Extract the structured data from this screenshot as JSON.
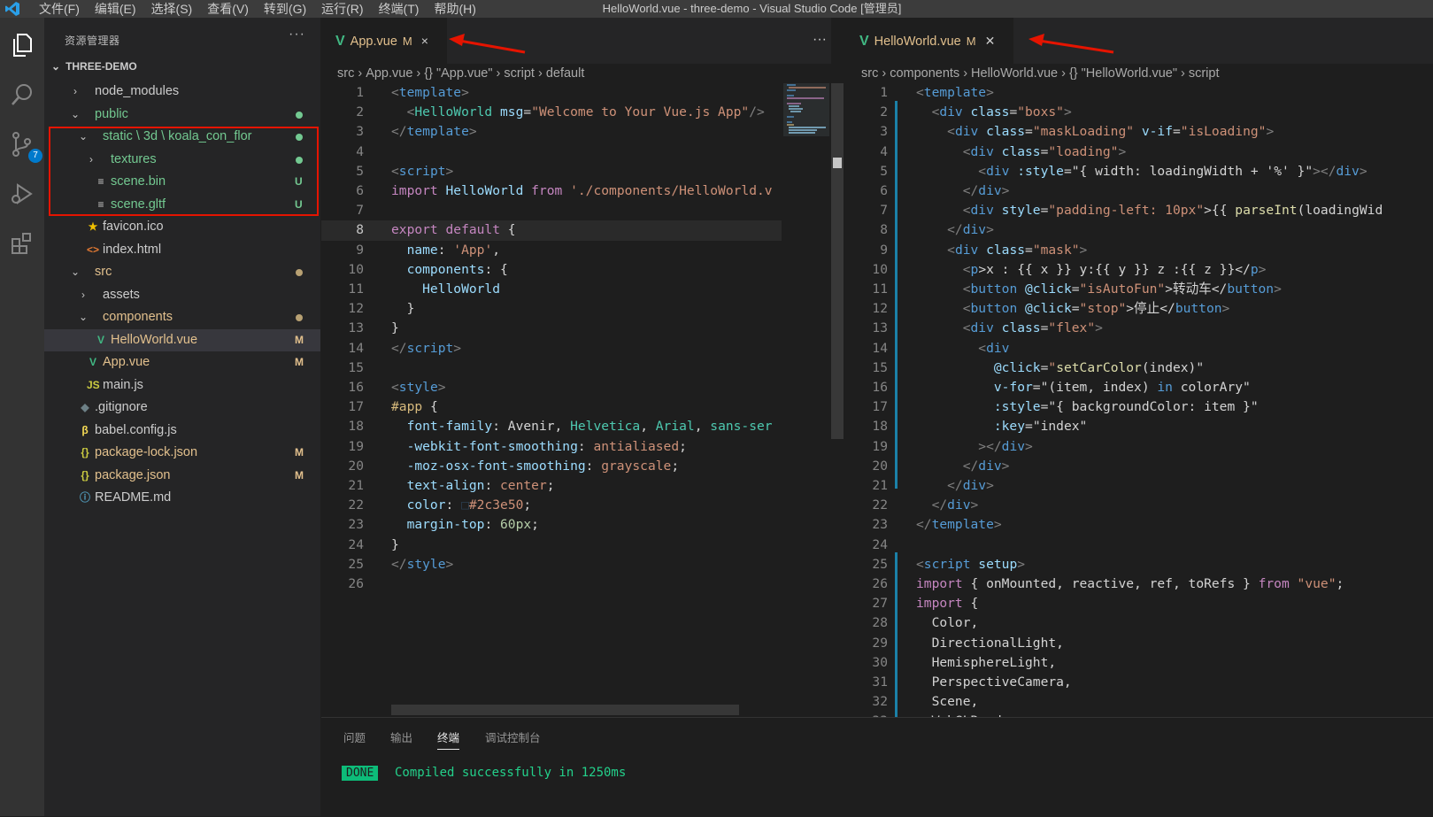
{
  "window": {
    "title": "HelloWorld.vue - three-demo - Visual Studio Code [管理员]",
    "menu": [
      "文件(F)",
      "编辑(E)",
      "选择(S)",
      "查看(V)",
      "转到(G)",
      "运行(R)",
      "终端(T)",
      "帮助(H)"
    ]
  },
  "activity": {
    "scm_badge": "7"
  },
  "explorer": {
    "title": "资源管理器",
    "more": "···",
    "section": "THREE-DEMO",
    "items": [
      {
        "twisty": "›",
        "icon": "",
        "name": "node_modules",
        "status": "",
        "color": "#cccccc"
      },
      {
        "twisty": "⌄",
        "icon": "",
        "name": "public",
        "status": "",
        "color": "#73c991"
      },
      {
        "twisty": "⌄",
        "icon": "",
        "name": "static \\ 3d \\ koala_con_flor",
        "status": "",
        "color": "#73c991"
      },
      {
        "twisty": "›",
        "icon": "",
        "name": "textures",
        "status": "",
        "color": "#73c991"
      },
      {
        "twisty": "",
        "icon": "≡",
        "name": "scene.bin",
        "status": "U",
        "color": "#73c991"
      },
      {
        "twisty": "",
        "icon": "≡",
        "name": "scene.gltf",
        "status": "U",
        "color": "#73c991"
      },
      {
        "twisty": "",
        "icon": "★",
        "name": "favicon.ico",
        "status": "",
        "color": "#cccccc"
      },
      {
        "twisty": "",
        "icon": "<>",
        "name": "index.html",
        "status": "",
        "color": "#cccccc"
      },
      {
        "twisty": "⌄",
        "icon": "",
        "name": "src",
        "status": "",
        "color": "#e2c08d"
      },
      {
        "twisty": "›",
        "icon": "",
        "name": "assets",
        "status": "",
        "color": "#cccccc"
      },
      {
        "twisty": "⌄",
        "icon": "",
        "name": "components",
        "status": "",
        "color": "#e2c08d"
      },
      {
        "twisty": "",
        "icon": "V",
        "name": "HelloWorld.vue",
        "status": "M",
        "color": "#e2c08d"
      },
      {
        "twisty": "",
        "icon": "V",
        "name": "App.vue",
        "status": "M",
        "color": "#e2c08d"
      },
      {
        "twisty": "",
        "icon": "JS",
        "name": "main.js",
        "status": "",
        "color": "#cccccc"
      },
      {
        "twisty": "",
        "icon": "◆",
        "name": ".gitignore",
        "status": "",
        "color": "#cccccc"
      },
      {
        "twisty": "",
        "icon": "β",
        "name": "babel.config.js",
        "status": "",
        "color": "#cccccc"
      },
      {
        "twisty": "",
        "icon": "{}",
        "name": "package-lock.json",
        "status": "M",
        "color": "#e2c08d"
      },
      {
        "twisty": "",
        "icon": "{}",
        "name": "package.json",
        "status": "M",
        "color": "#e2c08d"
      },
      {
        "twisty": "",
        "icon": "ⓘ",
        "name": "README.md",
        "status": "",
        "color": "#cccccc"
      }
    ]
  },
  "left_editor": {
    "tab": {
      "name": "App.vue",
      "mod": "M",
      "close": "×"
    },
    "more": "···",
    "breadcrumb": [
      "src",
      "›",
      "App.vue",
      "›",
      "{} \"App.vue\"",
      "›",
      "script",
      "›",
      "default"
    ],
    "current_line": 8,
    "lines": [
      [
        [
          "<",
          "#808080"
        ],
        [
          "template",
          "#569cd6"
        ],
        [
          ">",
          "#808080"
        ]
      ],
      [
        [
          "  <",
          "#808080"
        ],
        [
          "HelloWorld",
          "#4ec9b0"
        ],
        [
          " msg",
          "#9cdcfe"
        ],
        [
          "=",
          "#d4d4d4"
        ],
        [
          "\"Welcome to Your Vue.js App\"",
          "#ce9178"
        ],
        [
          "/>",
          "#808080"
        ]
      ],
      [
        [
          "</",
          "#808080"
        ],
        [
          "template",
          "#569cd6"
        ],
        [
          ">",
          "#808080"
        ]
      ],
      [],
      [
        [
          "<",
          "#808080"
        ],
        [
          "script",
          "#569cd6"
        ],
        [
          ">",
          "#808080"
        ]
      ],
      [
        [
          "import ",
          "#c586c0"
        ],
        [
          "HelloWorld ",
          "#9cdcfe"
        ],
        [
          "from ",
          "#c586c0"
        ],
        [
          "'./components/HelloWorld.v",
          "#ce9178"
        ]
      ],
      [],
      [
        [
          "export default ",
          "#c586c0"
        ],
        [
          "{",
          "#d4d4d4"
        ]
      ],
      [
        [
          "  name",
          "#9cdcfe"
        ],
        [
          ": ",
          "#d4d4d4"
        ],
        [
          "'App'",
          "#ce9178"
        ],
        [
          ",",
          "#d4d4d4"
        ]
      ],
      [
        [
          "  components",
          "#9cdcfe"
        ],
        [
          ": {",
          "#d4d4d4"
        ]
      ],
      [
        [
          "    HelloWorld",
          "#9cdcfe"
        ]
      ],
      [
        [
          "  }",
          "#d4d4d4"
        ]
      ],
      [
        [
          "}",
          "#d4d4d4"
        ]
      ],
      [
        [
          "</",
          "#808080"
        ],
        [
          "script",
          "#569cd6"
        ],
        [
          ">",
          "#808080"
        ]
      ],
      [],
      [
        [
          "<",
          "#808080"
        ],
        [
          "style",
          "#569cd6"
        ],
        [
          ">",
          "#808080"
        ]
      ],
      [
        [
          "#app ",
          "#d7ba7d"
        ],
        [
          "{",
          "#d4d4d4"
        ]
      ],
      [
        [
          "  font-family",
          "#9cdcfe"
        ],
        [
          ": Avenir, ",
          "#d4d4d4"
        ],
        [
          "Helvetica",
          "#4ec9b0"
        ],
        [
          ", ",
          "#d4d4d4"
        ],
        [
          "Arial",
          "#4ec9b0"
        ],
        [
          ", ",
          "#d4d4d4"
        ],
        [
          "sans-ser",
          "#4ec9b0"
        ]
      ],
      [
        [
          "  -webkit-font-smoothing",
          "#9cdcfe"
        ],
        [
          ": ",
          "#d4d4d4"
        ],
        [
          "antialiased",
          "#ce9178"
        ],
        [
          ";",
          "#d4d4d4"
        ]
      ],
      [
        [
          "  -moz-osx-font-smoothing",
          "#9cdcfe"
        ],
        [
          ": ",
          "#d4d4d4"
        ],
        [
          "grayscale",
          "#ce9178"
        ],
        [
          ";",
          "#d4d4d4"
        ]
      ],
      [
        [
          "  text-align",
          "#9cdcfe"
        ],
        [
          ": ",
          "#d4d4d4"
        ],
        [
          "center",
          "#ce9178"
        ],
        [
          ";",
          "#d4d4d4"
        ]
      ],
      [
        [
          "  color",
          "#9cdcfe"
        ],
        [
          ": ",
          "#d4d4d4"
        ],
        [
          "□",
          "#2c3e50"
        ],
        [
          "#2c3e50",
          "#ce9178"
        ],
        [
          ";",
          "#d4d4d4"
        ]
      ],
      [
        [
          "  margin-top",
          "#9cdcfe"
        ],
        [
          ": ",
          "#d4d4d4"
        ],
        [
          "60",
          "#b5cea8"
        ],
        [
          "px",
          "#b5cea8"
        ],
        [
          ";",
          "#d4d4d4"
        ]
      ],
      [
        [
          "}",
          "#d4d4d4"
        ]
      ],
      [
        [
          "</",
          "#808080"
        ],
        [
          "style",
          "#569cd6"
        ],
        [
          ">",
          "#808080"
        ]
      ],
      []
    ]
  },
  "right_editor": {
    "tab": {
      "name": "HelloWorld.vue",
      "mod": "M",
      "close": "✕"
    },
    "breadcrumb": [
      "src",
      "›",
      "components",
      "›",
      "HelloWorld.vue",
      "›",
      "{} \"HelloWorld.vue\"",
      "›",
      "script"
    ],
    "lines": [
      [
        [
          "<",
          "#808080"
        ],
        [
          "template",
          "#569cd6"
        ],
        [
          ">",
          "#808080"
        ]
      ],
      [
        [
          "  <",
          "#808080"
        ],
        [
          "div",
          "#569cd6"
        ],
        [
          " class",
          "#9cdcfe"
        ],
        [
          "=",
          "#d4d4d4"
        ],
        [
          "\"boxs\"",
          "#ce9178"
        ],
        [
          ">",
          "#808080"
        ]
      ],
      [
        [
          "    <",
          "#808080"
        ],
        [
          "div",
          "#569cd6"
        ],
        [
          " class",
          "#9cdcfe"
        ],
        [
          "=",
          "#d4d4d4"
        ],
        [
          "\"maskLoading\"",
          "#ce9178"
        ],
        [
          " v-if",
          "#9cdcfe"
        ],
        [
          "=",
          "#d4d4d4"
        ],
        [
          "\"isLoading\"",
          "#ce9178"
        ],
        [
          ">",
          "#808080"
        ]
      ],
      [
        [
          "      <",
          "#808080"
        ],
        [
          "div",
          "#569cd6"
        ],
        [
          " class",
          "#9cdcfe"
        ],
        [
          "=",
          "#d4d4d4"
        ],
        [
          "\"loading\"",
          "#ce9178"
        ],
        [
          ">",
          "#808080"
        ]
      ],
      [
        [
          "        <",
          "#808080"
        ],
        [
          "div",
          "#569cd6"
        ],
        [
          " :style",
          "#9cdcfe"
        ],
        [
          "=",
          "#d4d4d4"
        ],
        [
          "\"{ width: loadingWidth + '%' }\"",
          "#d4d4d4"
        ],
        [
          "></",
          "#808080"
        ],
        [
          "div",
          "#569cd6"
        ],
        [
          ">",
          "#808080"
        ]
      ],
      [
        [
          "      </",
          "#808080"
        ],
        [
          "div",
          "#569cd6"
        ],
        [
          ">",
          "#808080"
        ]
      ],
      [
        [
          "      <",
          "#808080"
        ],
        [
          "div",
          "#569cd6"
        ],
        [
          " style",
          "#9cdcfe"
        ],
        [
          "=",
          "#d4d4d4"
        ],
        [
          "\"padding-left: 10px\"",
          "#ce9178"
        ],
        [
          ">{{ ",
          "#d4d4d4"
        ],
        [
          "parseInt",
          "#dcdcaa"
        ],
        [
          "(loadingWid",
          "#d4d4d4"
        ]
      ],
      [
        [
          "    </",
          "#808080"
        ],
        [
          "div",
          "#569cd6"
        ],
        [
          ">",
          "#808080"
        ]
      ],
      [
        [
          "    <",
          "#808080"
        ],
        [
          "div",
          "#569cd6"
        ],
        [
          " class",
          "#9cdcfe"
        ],
        [
          "=",
          "#d4d4d4"
        ],
        [
          "\"mask\"",
          "#ce9178"
        ],
        [
          ">",
          "#808080"
        ]
      ],
      [
        [
          "      <",
          "#808080"
        ],
        [
          "p",
          "#569cd6"
        ],
        [
          ">x : {{ x }} y:{{ y }} z :{{ z }}</",
          "#d4d4d4"
        ],
        [
          "p",
          "#569cd6"
        ],
        [
          ">",
          "#808080"
        ]
      ],
      [
        [
          "      <",
          "#808080"
        ],
        [
          "button",
          "#569cd6"
        ],
        [
          " @click",
          "#9cdcfe"
        ],
        [
          "=",
          "#d4d4d4"
        ],
        [
          "\"isAutoFun\"",
          "#ce9178"
        ],
        [
          ">转动车</",
          "#d4d4d4"
        ],
        [
          "button",
          "#569cd6"
        ],
        [
          ">",
          "#808080"
        ]
      ],
      [
        [
          "      <",
          "#808080"
        ],
        [
          "button",
          "#569cd6"
        ],
        [
          " @click",
          "#9cdcfe"
        ],
        [
          "=",
          "#d4d4d4"
        ],
        [
          "\"stop\"",
          "#ce9178"
        ],
        [
          ">停止</",
          "#d4d4d4"
        ],
        [
          "button",
          "#569cd6"
        ],
        [
          ">",
          "#808080"
        ]
      ],
      [
        [
          "      <",
          "#808080"
        ],
        [
          "div",
          "#569cd6"
        ],
        [
          " class",
          "#9cdcfe"
        ],
        [
          "=",
          "#d4d4d4"
        ],
        [
          "\"flex\"",
          "#ce9178"
        ],
        [
          ">",
          "#808080"
        ]
      ],
      [
        [
          "        <",
          "#808080"
        ],
        [
          "div",
          "#569cd6"
        ]
      ],
      [
        [
          "          @click",
          "#9cdcfe"
        ],
        [
          "=",
          "#d4d4d4"
        ],
        [
          "\"",
          "#ce9178"
        ],
        [
          "setCarColor",
          "#dcdcaa"
        ],
        [
          "(index)\"",
          "#d4d4d4"
        ]
      ],
      [
        [
          "          v-for",
          "#9cdcfe"
        ],
        [
          "=",
          "#d4d4d4"
        ],
        [
          "\"(item, index) ",
          "#d4d4d4"
        ],
        [
          "in",
          "#569cd6"
        ],
        [
          " colorAry\"",
          "#d4d4d4"
        ]
      ],
      [
        [
          "          :style",
          "#9cdcfe"
        ],
        [
          "=",
          "#d4d4d4"
        ],
        [
          "\"{ backgroundColor: item }\"",
          "#d4d4d4"
        ]
      ],
      [
        [
          "          :key",
          "#9cdcfe"
        ],
        [
          "=",
          "#d4d4d4"
        ],
        [
          "\"index\"",
          "#d4d4d4"
        ]
      ],
      [
        [
          "        ></",
          "#808080"
        ],
        [
          "div",
          "#569cd6"
        ],
        [
          ">",
          "#808080"
        ]
      ],
      [
        [
          "      </",
          "#808080"
        ],
        [
          "div",
          "#569cd6"
        ],
        [
          ">",
          "#808080"
        ]
      ],
      [
        [
          "    </",
          "#808080"
        ],
        [
          "div",
          "#569cd6"
        ],
        [
          ">",
          "#808080"
        ]
      ],
      [
        [
          "  </",
          "#808080"
        ],
        [
          "div",
          "#569cd6"
        ],
        [
          ">",
          "#808080"
        ]
      ],
      [
        [
          "</",
          "#808080"
        ],
        [
          "template",
          "#569cd6"
        ],
        [
          ">",
          "#808080"
        ]
      ],
      [],
      [
        [
          "<",
          "#808080"
        ],
        [
          "script",
          "#569cd6"
        ],
        [
          " setup",
          "#9cdcfe"
        ],
        [
          ">",
          "#808080"
        ]
      ],
      [
        [
          "import ",
          "#c586c0"
        ],
        [
          "{ onMounted, reactive, ref, toRefs } ",
          "#d4d4d4"
        ],
        [
          "from ",
          "#c586c0"
        ],
        [
          "\"vue\"",
          "#ce9178"
        ],
        [
          ";",
          "#d4d4d4"
        ]
      ],
      [
        [
          "import ",
          "#c586c0"
        ],
        [
          "{",
          "#d4d4d4"
        ]
      ],
      [
        [
          "  Color,",
          "#d4d4d4"
        ]
      ],
      [
        [
          "  DirectionalLight,",
          "#d4d4d4"
        ]
      ],
      [
        [
          "  HemisphereLight,",
          "#d4d4d4"
        ]
      ],
      [
        [
          "  PerspectiveCamera,",
          "#d4d4d4"
        ]
      ],
      [
        [
          "  Scene,",
          "#d4d4d4"
        ]
      ],
      [
        [
          "  WebGLRenderer,",
          "#d4d4d4"
        ]
      ]
    ]
  },
  "panel": {
    "tabs": [
      "问题",
      "输出",
      "终端",
      "调试控制台"
    ],
    "active_tab": 2,
    "badge": "DONE",
    "message": "Compiled successfully in 1250ms"
  }
}
